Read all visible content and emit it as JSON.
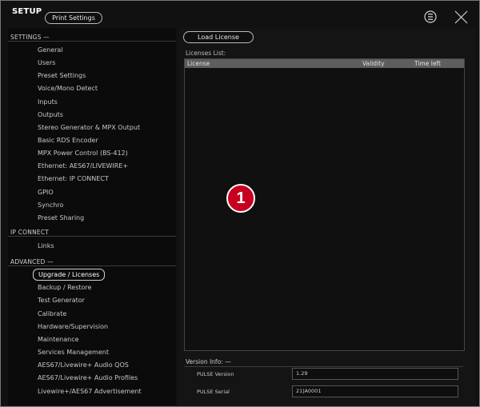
{
  "header": {
    "title": "SETUP",
    "print_settings_label": "Print Settings"
  },
  "sidebar": {
    "settings_label": "SETTINGS —",
    "settings_items": [
      "General",
      "Users",
      "Preset Settings",
      "Voice/Mono Detect",
      "Inputs",
      "Outputs",
      "Stereo Generator & MPX Output",
      "Basic RDS Encoder",
      "MPX Power Control (BS-412)",
      "Ethernet: AES67/LIVEWIRE+",
      "Ethernet: IP CONNECT",
      "GPIO",
      "Synchro",
      "Preset Sharing"
    ],
    "ipconnect_label": "IP CONNECT",
    "ipconnect_items": [
      "Links"
    ],
    "advanced_label": "ADVANCED —",
    "advanced_items": [
      "Upgrade / Licenses",
      "Backup / Restore",
      "Test Generator",
      "Calibrate",
      "Hardware/Supervision",
      "Maintenance",
      "Services Management",
      "AES67/Livewire+ Audio QOS",
      "AES67/Livewire+ Audio Profiles",
      "Livewire+/AES67 Advertisement"
    ]
  },
  "main": {
    "load_license_label": "Load License",
    "licenses_list_label": "Licenses List:",
    "columns": [
      "License",
      "Validity",
      "Time left"
    ],
    "callout": "1"
  },
  "version_info": {
    "label": "Version Info: —",
    "rows": [
      {
        "label": "PULSE Version",
        "value": "1.29"
      },
      {
        "label": "PULSE Serial",
        "value": "21|A0001"
      }
    ]
  }
}
